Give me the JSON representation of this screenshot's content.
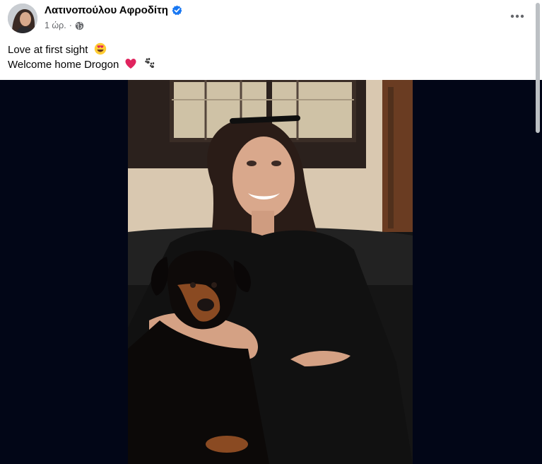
{
  "post": {
    "author": "Λατινοπούλου Αφροδίτη",
    "time": "1 ώρ.",
    "separator": "·",
    "caption_line1": "Love at first sight",
    "caption_line2": "Welcome home Drogon"
  },
  "colors": {
    "verified_badge": "#1877f2",
    "media_background": "#020617"
  },
  "icons": [
    "verified-badge-icon",
    "globe-icon",
    "more-options-icon",
    "heart-eyes-emoji",
    "red-heart-emoji",
    "paw-prints-emoji"
  ]
}
